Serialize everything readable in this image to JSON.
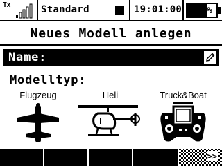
{
  "status_bar": {
    "tx_label": "Tx",
    "signal_icon": "signal-strength-icon",
    "model_name": "Standard",
    "stop_icon": "stop-icon",
    "timer": "19:01:00",
    "battery_percent": "67%",
    "battery_level": 0.67
  },
  "page": {
    "title": "Neues Modell anlegen"
  },
  "name_field": {
    "label": "Name:",
    "value": "",
    "edit_icon": "edit-pencil-icon"
  },
  "model_type": {
    "label": "Modelltyp:",
    "options": [
      {
        "label": "Flugzeug",
        "icon": "airplane-icon"
      },
      {
        "label": "Heli",
        "icon": "helicopter-icon"
      },
      {
        "label": "Truck&Boat",
        "icon": "controller-icon"
      }
    ]
  },
  "soft_keys": {
    "next_label": ">>"
  }
}
